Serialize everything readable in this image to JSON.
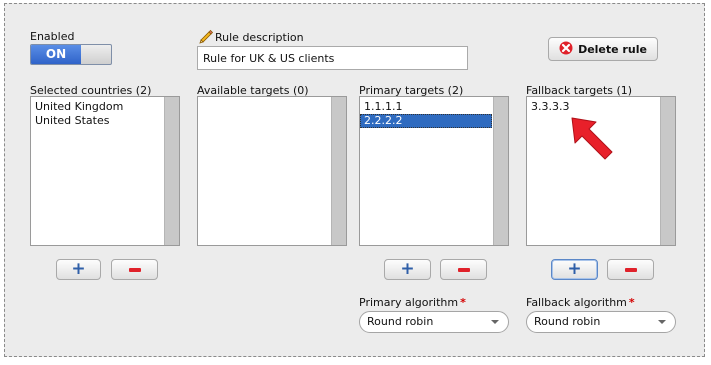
{
  "enabled": {
    "label": "Enabled",
    "toggle_text": "ON"
  },
  "rule_description": {
    "label": "Rule description",
    "value": "Rule for UK & US clients"
  },
  "delete_button": {
    "label": "Delete rule"
  },
  "lists": {
    "selected_countries": {
      "label": "Selected countries (2)",
      "items": [
        "United Kingdom",
        "United States"
      ]
    },
    "available_targets": {
      "label": "Available targets (0)",
      "items": []
    },
    "primary_targets": {
      "label": "Primary targets (2)",
      "items": [
        "1.1.1.1",
        "2.2.2.2"
      ],
      "selected": "2.2.2.2"
    },
    "fallback_targets": {
      "label": "Fallback targets (1)",
      "items": [
        "3.3.3.3"
      ]
    }
  },
  "primary_algorithm": {
    "label": "Primary algorithm",
    "required": "*",
    "value": "Round robin"
  },
  "fallback_algorithm": {
    "label": "Fallback algorithm",
    "required": "*",
    "value": "Round robin"
  },
  "colors": {
    "accent": "#2f6bc0",
    "danger": "#e0212a",
    "arrow": "#e8202a"
  }
}
